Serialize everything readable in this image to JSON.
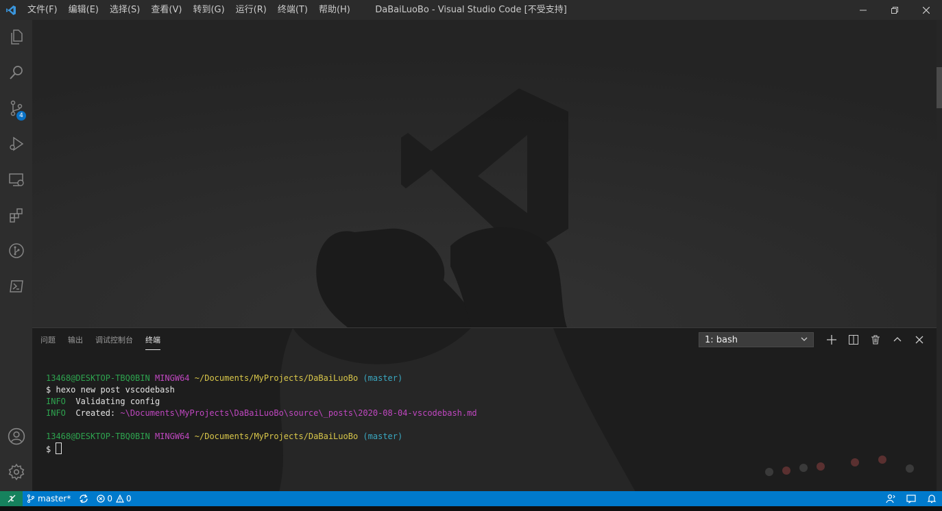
{
  "titlebar": {
    "menu": [
      {
        "name": "menu-file",
        "label": "文件(F)"
      },
      {
        "name": "menu-edit",
        "label": "编辑(E)"
      },
      {
        "name": "menu-selection",
        "label": "选择(S)"
      },
      {
        "name": "menu-view",
        "label": "查看(V)"
      },
      {
        "name": "menu-go",
        "label": "转到(G)"
      },
      {
        "name": "menu-run",
        "label": "运行(R)"
      },
      {
        "name": "menu-terminal",
        "label": "终端(T)"
      },
      {
        "name": "menu-help",
        "label": "帮助(H)"
      }
    ],
    "title": "DaBaiLuoBo - Visual Studio Code [不受支持]"
  },
  "activity": {
    "icons": [
      "explorer-icon",
      "search-icon",
      "source-control-icon",
      "run-debug-icon",
      "remote-explorer-icon",
      "extensions-icon",
      "git-graph-icon",
      "powershell-icon",
      "account-icon",
      "settings-gear-icon"
    ],
    "scm_badge": "4"
  },
  "panel": {
    "tabs": [
      {
        "name": "tab-problems",
        "label": "问题"
      },
      {
        "name": "tab-output",
        "label": "输出"
      },
      {
        "name": "tab-debug-console",
        "label": "调试控制台"
      },
      {
        "name": "tab-terminal",
        "label": "终端"
      }
    ],
    "active_tab": "终端",
    "terminal_select": "1: bash"
  },
  "terminal": {
    "user_host": "13468@DESKTOP-TBQ0BIN",
    "env": "MINGW64",
    "path": "~/Documents/MyProjects/DaBaiLuoBo",
    "branch": "(master)",
    "prompt": "$",
    "command": "hexo new post vscodebash",
    "info_tag": "INFO",
    "info_1": "Validating config",
    "info_2_label": "Created:",
    "info_2_path": "~\\Documents\\MyProjects\\DaBaiLuoBo\\source\\_posts\\2020-08-04-vscodebash.md"
  },
  "statusbar": {
    "branch": "master*",
    "errors": "0",
    "warnings": "0"
  },
  "colors": {
    "statusbar": "#007acc",
    "remote": "#16825d",
    "titlebar": "#2b2b2b",
    "activitybar": "#2d2d2d"
  }
}
